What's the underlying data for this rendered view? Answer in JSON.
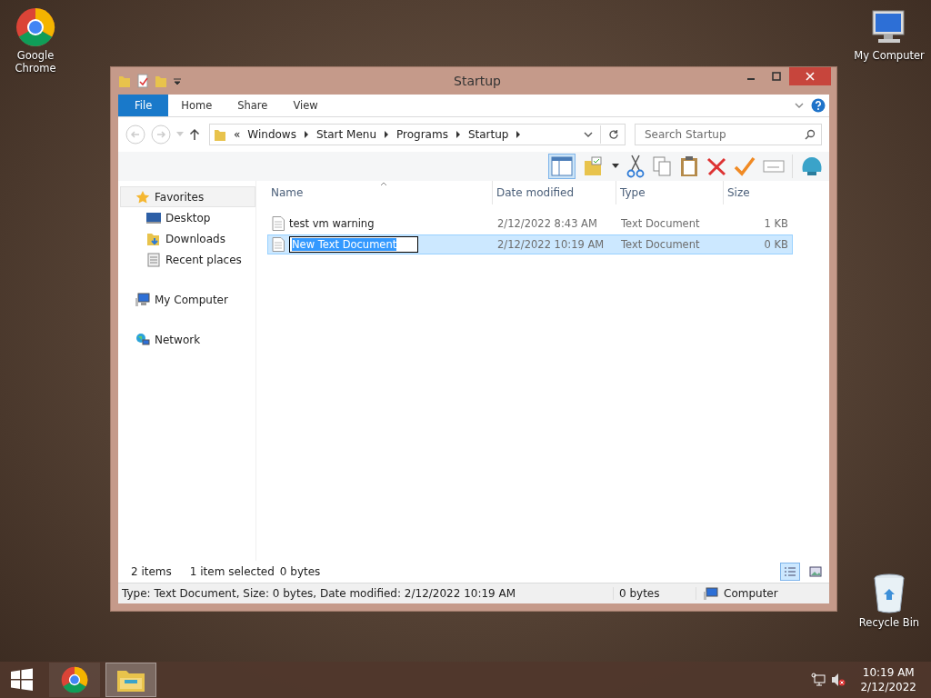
{
  "desktop_icons": [
    {
      "label": "Google Chrome",
      "kind": "chrome"
    },
    {
      "label": "My Computer",
      "kind": "computer"
    },
    {
      "label": "Recycle Bin",
      "kind": "bin"
    }
  ],
  "window": {
    "title": "Startup"
  },
  "ribbon_tabs": [
    {
      "label": "File",
      "kind": "file"
    },
    {
      "label": "Home",
      "kind": "tab"
    },
    {
      "label": "Share",
      "kind": "tab"
    },
    {
      "label": "View",
      "kind": "tab"
    }
  ],
  "address": {
    "prefix": "«",
    "segments": [
      "Windows",
      "Start Menu",
      "Programs",
      "Startup"
    ]
  },
  "search": {
    "placeholder": "Search Startup"
  },
  "nav": [
    {
      "label": "Favorites",
      "kind": "star",
      "selected": true,
      "children": [
        {
          "label": "Desktop",
          "kind": "desktop",
          "selected": false
        },
        {
          "label": "Downloads",
          "kind": "downloads",
          "selected": false
        },
        {
          "label": "Recent places",
          "kind": "recent",
          "selected": false
        }
      ]
    },
    {
      "label": "My Computer",
      "kind": "computer",
      "selected": false
    },
    {
      "label": "Network",
      "kind": "network",
      "selected": false
    }
  ],
  "columns": [
    "Name",
    "Date modified",
    "Type",
    "Size"
  ],
  "rows": [
    {
      "name": "test vm warning",
      "date": "2/12/2022 8:43 AM",
      "type": "Text Document",
      "size": "1 KB",
      "selected": false,
      "editing": false
    },
    {
      "name": "New Text Document",
      "date": "2/12/2022 10:19 AM",
      "type": "Text Document",
      "size": "0 KB",
      "selected": true,
      "editing": true
    }
  ],
  "status": {
    "items": "2 items",
    "selection": "1 item selected",
    "selection_size": "0 bytes",
    "details_view": true
  },
  "status_bar": {
    "details": "Type: Text Document, Size: 0 bytes, Date modified: 2/12/2022 10:19 AM",
    "size": "0 bytes",
    "location": "Computer"
  },
  "taskbar": [
    {
      "kind": "chrome",
      "active": false
    },
    {
      "kind": "explorer",
      "active": true
    }
  ],
  "clock": {
    "time": "10:19 AM",
    "date": "2/12/2022"
  }
}
